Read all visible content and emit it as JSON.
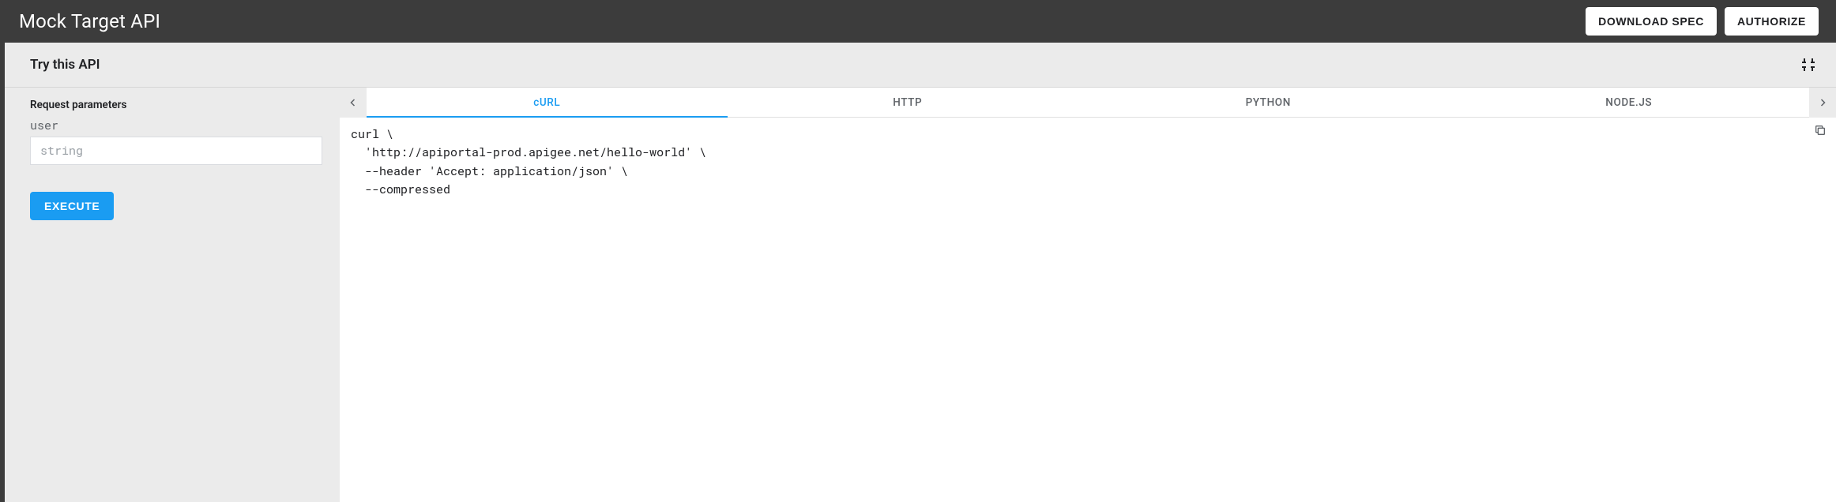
{
  "header": {
    "title": "Mock Target API",
    "download": "DOWNLOAD SPEC",
    "authorize": "AUTHORIZE"
  },
  "panel": {
    "title": "Try this API"
  },
  "request": {
    "section_label": "Request parameters",
    "param_name": "user",
    "placeholder": "string",
    "execute": "EXECUTE"
  },
  "tabs": {
    "items": [
      "cURL",
      "HTTP",
      "PYTHON",
      "NODE.JS"
    ],
    "active_index": 0
  },
  "code": "curl \\\n  'http://apiportal-prod.apigee.net/hello-world' \\\n  --header 'Accept: application/json' \\\n  --compressed"
}
